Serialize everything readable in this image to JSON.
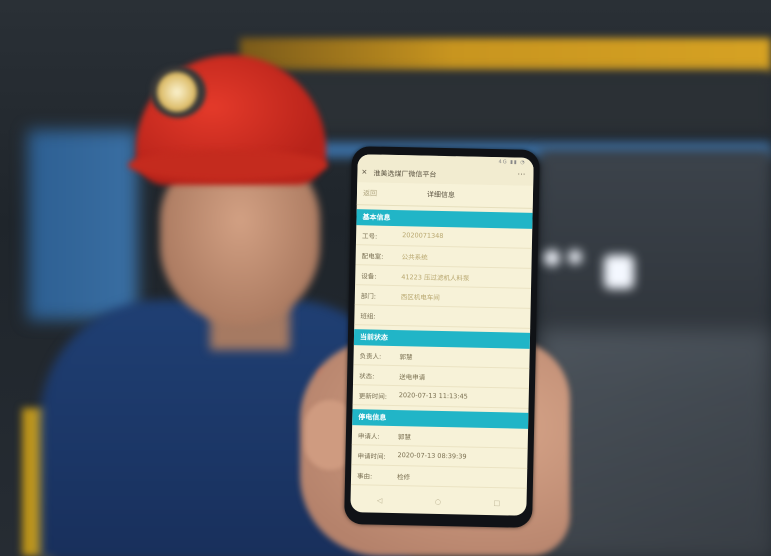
{
  "phone": {
    "status_icons": "4G ▮▮ ◔",
    "app_title": "淮美选煤厂微信平台",
    "close_icon": "close-icon",
    "more_icon": "more-icon",
    "back_label": "返回",
    "page_title": "详细信息",
    "sections": {
      "basic": {
        "title": "基本信息",
        "rows": [
          {
            "key": "工号:",
            "value": "2020071348"
          },
          {
            "key": "配电室:",
            "value": "公共系统"
          },
          {
            "key": "设备:",
            "value": "41223 压过滤机人料泵"
          },
          {
            "key": "部门:",
            "value": "西区机电车间"
          },
          {
            "key": "班组:",
            "value": ""
          }
        ]
      },
      "status": {
        "title": "当前状态",
        "rows": [
          {
            "key": "负责人:",
            "value": "郭慧"
          },
          {
            "key": "状态:",
            "value": "送电申请"
          },
          {
            "key": "更新时间:",
            "value": "2020-07-13 11:13:45"
          }
        ]
      },
      "outage": {
        "title": "停电信息",
        "rows": [
          {
            "key": "申请人:",
            "value": "郭慧"
          },
          {
            "key": "申请时间:",
            "value": "2020-07-13 08:39:39"
          },
          {
            "key": "事由:",
            "value": "检修"
          }
        ]
      }
    },
    "bottom_nav": [
      "◁",
      "○",
      "□"
    ]
  },
  "colors": {
    "section_header": "#21b5c7",
    "screen_background": "#f7f2d8",
    "helmet": "#c42b1e",
    "uniform": "#1f3f73"
  }
}
